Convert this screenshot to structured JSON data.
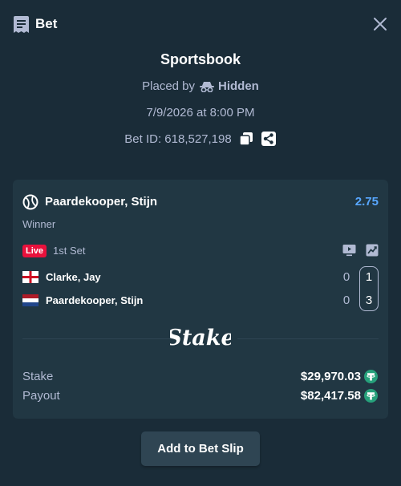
{
  "colors": {
    "background": "#1a2c38",
    "card": "#213743",
    "accent_odds": "#58a7ff",
    "live_red": "#e9113c",
    "text_muted": "#b1bad3",
    "tether_green": "#26a17b",
    "button": "#2f4553"
  },
  "header": {
    "title": "Bet",
    "icon": "betslip-icon",
    "close_icon": "close-icon"
  },
  "summary": {
    "title": "Sportsbook",
    "placed_prefix": "Placed by",
    "placed_user": "Hidden",
    "datetime": "7/9/2026 at 8:00 PM",
    "bet_id": "Bet ID: 618,527,198",
    "copy_icon": "copy-icon",
    "share_icon": "share-icon"
  },
  "selection": {
    "name": "Paardekooper, Stijn",
    "odds": "2.75",
    "market": "Winner",
    "sport_icon": "tennis-icon"
  },
  "match": {
    "live_label": "Live",
    "period": "1st Set",
    "teams": [
      {
        "name": "Clarke, Jay",
        "flag": "england",
        "set_score": "0",
        "current_score": "1"
      },
      {
        "name": "Paardekooper, Stijn",
        "flag": "netherlands",
        "set_score": "0",
        "current_score": "3"
      }
    ]
  },
  "brand": "Stake",
  "totals": {
    "stake_label": "Stake",
    "stake_value": "$29,970.03",
    "payout_label": "Payout",
    "payout_value": "$82,417.58",
    "currency_icon": "tether-icon"
  },
  "actions": {
    "add_to_slip": "Add to Bet Slip"
  }
}
